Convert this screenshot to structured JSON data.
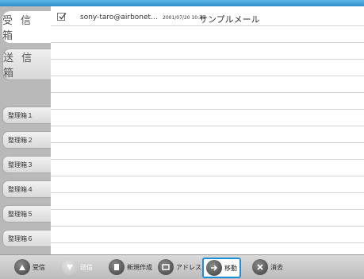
{
  "folders": {
    "inbox": "受 信 箱",
    "sent": "送 信 箱",
    "boxes": [
      "整理箱１",
      "整理箱２",
      "整理箱３",
      "整理箱４",
      "整理箱５",
      "整理箱６"
    ]
  },
  "messages": [
    {
      "checked": true,
      "from": "sony-taro@airbonet…",
      "date": "2001/07/20 10:35",
      "subject": "サンプルメール"
    }
  ],
  "toolbar": {
    "receive": "受信",
    "send": "送信",
    "compose": "新規作成",
    "address": "アドレス",
    "move": "移動",
    "delete": "消去"
  },
  "colors": {
    "accent": "#1d8fd6",
    "topbar": "#3a9bd4",
    "sidebar": "#b9b9b9"
  }
}
